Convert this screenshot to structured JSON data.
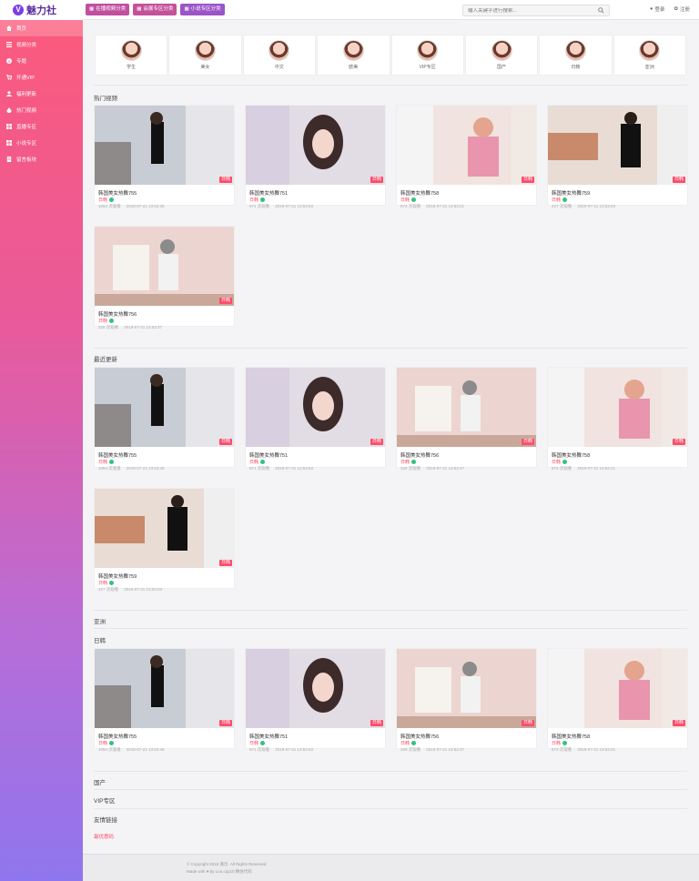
{
  "app": {
    "logo_mark": "V",
    "logo_text": "魅力社"
  },
  "header": {
    "category_buttons": [
      "在播视频分类",
      "会展专区分类",
      "小说专区分类"
    ],
    "search_placeholder": "输入关键字进行搜索...",
    "login_label": "登录",
    "register_label": "注册"
  },
  "sidebar": {
    "items": [
      {
        "label": "首页",
        "icon": "home-icon",
        "active": true
      },
      {
        "label": "视频分类",
        "icon": "list-icon",
        "active": false
      },
      {
        "label": "专题",
        "icon": "info-icon",
        "active": false
      },
      {
        "label": "开通VIP",
        "icon": "cart-icon",
        "active": false
      },
      {
        "label": "福利更新",
        "icon": "user-icon",
        "active": false
      },
      {
        "label": "热门视频",
        "icon": "fire-icon",
        "active": false
      },
      {
        "label": "直播专区",
        "icon": "grid-icon",
        "active": false
      },
      {
        "label": "小说专区",
        "icon": "grid-icon",
        "active": false
      },
      {
        "label": "留言板块",
        "icon": "doc-icon",
        "active": false
      }
    ]
  },
  "channels": [
    {
      "label": "学生"
    },
    {
      "label": "美女"
    },
    {
      "label": "中文"
    },
    {
      "label": "欧美"
    },
    {
      "label": "VIP专区"
    },
    {
      "label": "国产"
    },
    {
      "label": "日韩"
    },
    {
      "label": "亚洲"
    }
  ],
  "sections": {
    "hot": {
      "title": "热门视频"
    },
    "recent": {
      "title": "最近更新"
    },
    "asia": {
      "title": "亚洲"
    },
    "japan_korea": {
      "title": "日韩"
    },
    "domestic": {
      "title": "国产"
    },
    "vip": {
      "title": "VIP专区"
    },
    "friend": {
      "title": "友情链接",
      "link": "最优惠码"
    }
  },
  "videos": {
    "v755": {
      "title": "韩国美女热舞755",
      "tag": "日韩",
      "views": "1084 次观看",
      "date": "2019-07-21 13:53:46",
      "badge": "日韩"
    },
    "v751": {
      "title": "韩国美女热舞751",
      "tag": "日韩",
      "views": "971 次观看",
      "date": "2019-07-21 13:53:53",
      "badge": "日韩"
    },
    "v758": {
      "title": "韩国美女热舞758",
      "tag": "日韩",
      "views": "873 次观看",
      "date": "2019-07-21 13:53:21",
      "badge": "日韩"
    },
    "v759": {
      "title": "韩国美女热舞759",
      "tag": "日韩",
      "views": "427 次观看",
      "date": "2019-07-21 13:53:03",
      "badge": "日韩"
    },
    "v756": {
      "title": "韩国美女热舞756",
      "tag": "日韩",
      "views": "328 次观看",
      "date": "2019-07-21 13:53:37",
      "badge": "日韩"
    }
  },
  "footer": {
    "copyright": "© Copyright 2018 演示. All Rights Reserved",
    "made_with": "Made with ♥ by Luo.cqy10 精仿代码"
  },
  "colors": {
    "accent": "#ff4b6a",
    "sidebar_top": "#fb5a7c",
    "sidebar_bottom": "#8f76ee"
  }
}
